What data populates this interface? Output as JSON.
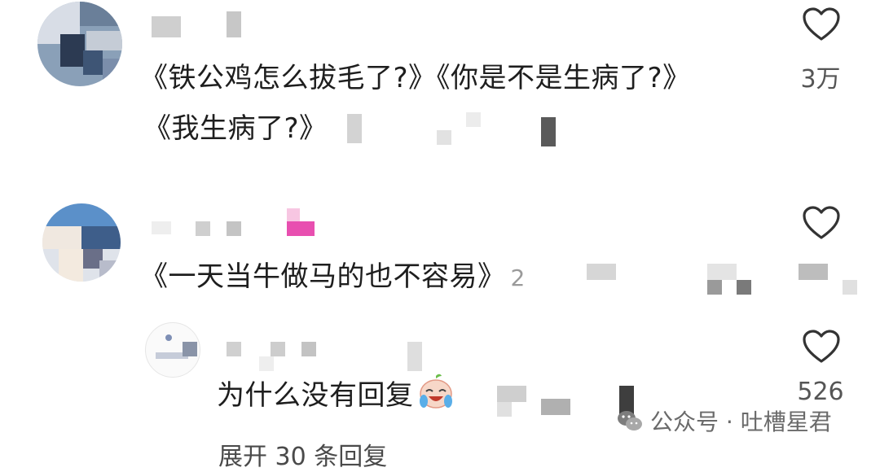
{
  "comments": [
    {
      "text_line1": "《铁公鸡怎么拔毛了?》《你是不是生病了?》",
      "text_line2": "《我生病了?》",
      "like_count": "3万",
      "like_icon": "heart-outline-icon"
    },
    {
      "text_line1": "《一天当牛做马的也不容易》",
      "inline_number": "2",
      "like_icon": "heart-outline-icon"
    },
    {
      "text_line1": "为什么没有回复",
      "emoji": "crying-laughing-face-icon",
      "like_count": "526",
      "like_icon": "heart-outline-icon"
    }
  ],
  "expand_replies": "展开 30 条回复",
  "watermark": {
    "icon": "wechat-icon",
    "text": "公众号 · 吐槽星君"
  },
  "colors": {
    "heart_stroke": "#333333",
    "pink_mosaic": "#e84fb0"
  }
}
